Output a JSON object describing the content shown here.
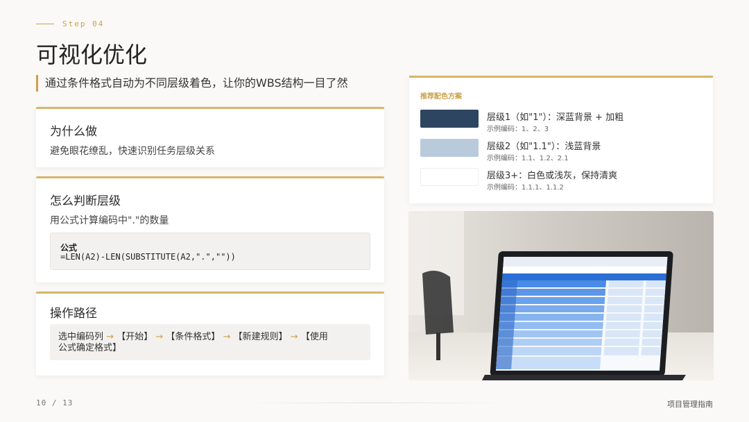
{
  "header": {
    "step": "Step 04",
    "title": "可视化优化",
    "subtitle": "通过条件格式自动为不同层级着色，让你的WBS结构一目了然"
  },
  "cards": {
    "why": {
      "title": "为什么做",
      "text": "避免眼花缭乱，快速识别任务层级关系"
    },
    "how": {
      "title": "怎么判断层级",
      "text": "用公式计算编码中\".\"的数量",
      "formula_label": "公式",
      "formula": "=LEN(A2)-LEN(SUBSTITUTE(A2,\".\",\"\"))"
    },
    "path": {
      "title": "操作路径",
      "steps": [
        "选中编码列",
        "【开始】",
        "【条件格式】",
        "【新建规则】",
        "【使用公式确定格式】"
      ],
      "arrow": "→"
    }
  },
  "palette": {
    "title": "推荐配色方案",
    "levels": [
      {
        "label": "层级1（如\"1\"）：深蓝背景 + 加粗",
        "example": "示例编码：1、2、3",
        "color": "#2d4560"
      },
      {
        "label": "层级2（如\"1.1\"）：浅蓝背景",
        "example": "示例编码：1.1、1.2、2.1",
        "color": "#b9cbdb"
      },
      {
        "label": "层级3+：白色或浅灰，保持清爽",
        "example": "示例编码：1.1.1、1.1.2",
        "color": "#ffffff"
      }
    ]
  },
  "photo": {
    "icon": "laptop-spreadsheet-photo"
  },
  "footer": {
    "page": "10 / 13",
    "doc_title": "项目管理指南"
  },
  "colors": {
    "accent": "#c9a24a"
  }
}
